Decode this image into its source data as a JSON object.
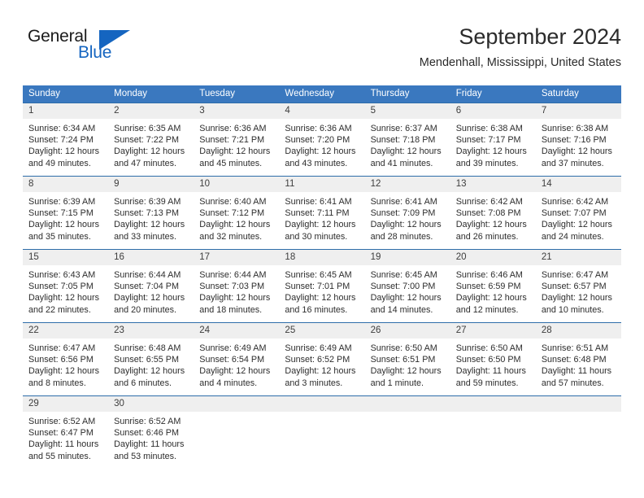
{
  "brand": {
    "name_top": "General",
    "name_bottom": "Blue",
    "accent_color": "#1565c0"
  },
  "header": {
    "month_title": "September 2024",
    "location": "Mendenhall, Mississippi, United States"
  },
  "theme": {
    "header_row_bg": "#3a78bf",
    "row_border": "#2e6da9",
    "daynum_bg": "#efefef",
    "text": "#2d2d2d"
  },
  "weekday_headers": [
    "Sunday",
    "Monday",
    "Tuesday",
    "Wednesday",
    "Thursday",
    "Friday",
    "Saturday"
  ],
  "weeks": [
    [
      {
        "day": "1",
        "sunrise": "Sunrise: 6:34 AM",
        "sunset": "Sunset: 7:24 PM",
        "daylight_line1": "Daylight: 12 hours",
        "daylight_line2": "and 49 minutes."
      },
      {
        "day": "2",
        "sunrise": "Sunrise: 6:35 AM",
        "sunset": "Sunset: 7:22 PM",
        "daylight_line1": "Daylight: 12 hours",
        "daylight_line2": "and 47 minutes."
      },
      {
        "day": "3",
        "sunrise": "Sunrise: 6:36 AM",
        "sunset": "Sunset: 7:21 PM",
        "daylight_line1": "Daylight: 12 hours",
        "daylight_line2": "and 45 minutes."
      },
      {
        "day": "4",
        "sunrise": "Sunrise: 6:36 AM",
        "sunset": "Sunset: 7:20 PM",
        "daylight_line1": "Daylight: 12 hours",
        "daylight_line2": "and 43 minutes."
      },
      {
        "day": "5",
        "sunrise": "Sunrise: 6:37 AM",
        "sunset": "Sunset: 7:18 PM",
        "daylight_line1": "Daylight: 12 hours",
        "daylight_line2": "and 41 minutes."
      },
      {
        "day": "6",
        "sunrise": "Sunrise: 6:38 AM",
        "sunset": "Sunset: 7:17 PM",
        "daylight_line1": "Daylight: 12 hours",
        "daylight_line2": "and 39 minutes."
      },
      {
        "day": "7",
        "sunrise": "Sunrise: 6:38 AM",
        "sunset": "Sunset: 7:16 PM",
        "daylight_line1": "Daylight: 12 hours",
        "daylight_line2": "and 37 minutes."
      }
    ],
    [
      {
        "day": "8",
        "sunrise": "Sunrise: 6:39 AM",
        "sunset": "Sunset: 7:15 PM",
        "daylight_line1": "Daylight: 12 hours",
        "daylight_line2": "and 35 minutes."
      },
      {
        "day": "9",
        "sunrise": "Sunrise: 6:39 AM",
        "sunset": "Sunset: 7:13 PM",
        "daylight_line1": "Daylight: 12 hours",
        "daylight_line2": "and 33 minutes."
      },
      {
        "day": "10",
        "sunrise": "Sunrise: 6:40 AM",
        "sunset": "Sunset: 7:12 PM",
        "daylight_line1": "Daylight: 12 hours",
        "daylight_line2": "and 32 minutes."
      },
      {
        "day": "11",
        "sunrise": "Sunrise: 6:41 AM",
        "sunset": "Sunset: 7:11 PM",
        "daylight_line1": "Daylight: 12 hours",
        "daylight_line2": "and 30 minutes."
      },
      {
        "day": "12",
        "sunrise": "Sunrise: 6:41 AM",
        "sunset": "Sunset: 7:09 PM",
        "daylight_line1": "Daylight: 12 hours",
        "daylight_line2": "and 28 minutes."
      },
      {
        "day": "13",
        "sunrise": "Sunrise: 6:42 AM",
        "sunset": "Sunset: 7:08 PM",
        "daylight_line1": "Daylight: 12 hours",
        "daylight_line2": "and 26 minutes."
      },
      {
        "day": "14",
        "sunrise": "Sunrise: 6:42 AM",
        "sunset": "Sunset: 7:07 PM",
        "daylight_line1": "Daylight: 12 hours",
        "daylight_line2": "and 24 minutes."
      }
    ],
    [
      {
        "day": "15",
        "sunrise": "Sunrise: 6:43 AM",
        "sunset": "Sunset: 7:05 PM",
        "daylight_line1": "Daylight: 12 hours",
        "daylight_line2": "and 22 minutes."
      },
      {
        "day": "16",
        "sunrise": "Sunrise: 6:44 AM",
        "sunset": "Sunset: 7:04 PM",
        "daylight_line1": "Daylight: 12 hours",
        "daylight_line2": "and 20 minutes."
      },
      {
        "day": "17",
        "sunrise": "Sunrise: 6:44 AM",
        "sunset": "Sunset: 7:03 PM",
        "daylight_line1": "Daylight: 12 hours",
        "daylight_line2": "and 18 minutes."
      },
      {
        "day": "18",
        "sunrise": "Sunrise: 6:45 AM",
        "sunset": "Sunset: 7:01 PM",
        "daylight_line1": "Daylight: 12 hours",
        "daylight_line2": "and 16 minutes."
      },
      {
        "day": "19",
        "sunrise": "Sunrise: 6:45 AM",
        "sunset": "Sunset: 7:00 PM",
        "daylight_line1": "Daylight: 12 hours",
        "daylight_line2": "and 14 minutes."
      },
      {
        "day": "20",
        "sunrise": "Sunrise: 6:46 AM",
        "sunset": "Sunset: 6:59 PM",
        "daylight_line1": "Daylight: 12 hours",
        "daylight_line2": "and 12 minutes."
      },
      {
        "day": "21",
        "sunrise": "Sunrise: 6:47 AM",
        "sunset": "Sunset: 6:57 PM",
        "daylight_line1": "Daylight: 12 hours",
        "daylight_line2": "and 10 minutes."
      }
    ],
    [
      {
        "day": "22",
        "sunrise": "Sunrise: 6:47 AM",
        "sunset": "Sunset: 6:56 PM",
        "daylight_line1": "Daylight: 12 hours",
        "daylight_line2": "and 8 minutes."
      },
      {
        "day": "23",
        "sunrise": "Sunrise: 6:48 AM",
        "sunset": "Sunset: 6:55 PM",
        "daylight_line1": "Daylight: 12 hours",
        "daylight_line2": "and 6 minutes."
      },
      {
        "day": "24",
        "sunrise": "Sunrise: 6:49 AM",
        "sunset": "Sunset: 6:54 PM",
        "daylight_line1": "Daylight: 12 hours",
        "daylight_line2": "and 4 minutes."
      },
      {
        "day": "25",
        "sunrise": "Sunrise: 6:49 AM",
        "sunset": "Sunset: 6:52 PM",
        "daylight_line1": "Daylight: 12 hours",
        "daylight_line2": "and 3 minutes."
      },
      {
        "day": "26",
        "sunrise": "Sunrise: 6:50 AM",
        "sunset": "Sunset: 6:51 PM",
        "daylight_line1": "Daylight: 12 hours",
        "daylight_line2": "and 1 minute."
      },
      {
        "day": "27",
        "sunrise": "Sunrise: 6:50 AM",
        "sunset": "Sunset: 6:50 PM",
        "daylight_line1": "Daylight: 11 hours",
        "daylight_line2": "and 59 minutes."
      },
      {
        "day": "28",
        "sunrise": "Sunrise: 6:51 AM",
        "sunset": "Sunset: 6:48 PM",
        "daylight_line1": "Daylight: 11 hours",
        "daylight_line2": "and 57 minutes."
      }
    ],
    [
      {
        "day": "29",
        "sunrise": "Sunrise: 6:52 AM",
        "sunset": "Sunset: 6:47 PM",
        "daylight_line1": "Daylight: 11 hours",
        "daylight_line2": "and 55 minutes."
      },
      {
        "day": "30",
        "sunrise": "Sunrise: 6:52 AM",
        "sunset": "Sunset: 6:46 PM",
        "daylight_line1": "Daylight: 11 hours",
        "daylight_line2": "and 53 minutes."
      },
      {
        "day": "",
        "sunrise": "",
        "sunset": "",
        "daylight_line1": "",
        "daylight_line2": ""
      },
      {
        "day": "",
        "sunrise": "",
        "sunset": "",
        "daylight_line1": "",
        "daylight_line2": ""
      },
      {
        "day": "",
        "sunrise": "",
        "sunset": "",
        "daylight_line1": "",
        "daylight_line2": ""
      },
      {
        "day": "",
        "sunrise": "",
        "sunset": "",
        "daylight_line1": "",
        "daylight_line2": ""
      },
      {
        "day": "",
        "sunrise": "",
        "sunset": "",
        "daylight_line1": "",
        "daylight_line2": ""
      }
    ]
  ]
}
